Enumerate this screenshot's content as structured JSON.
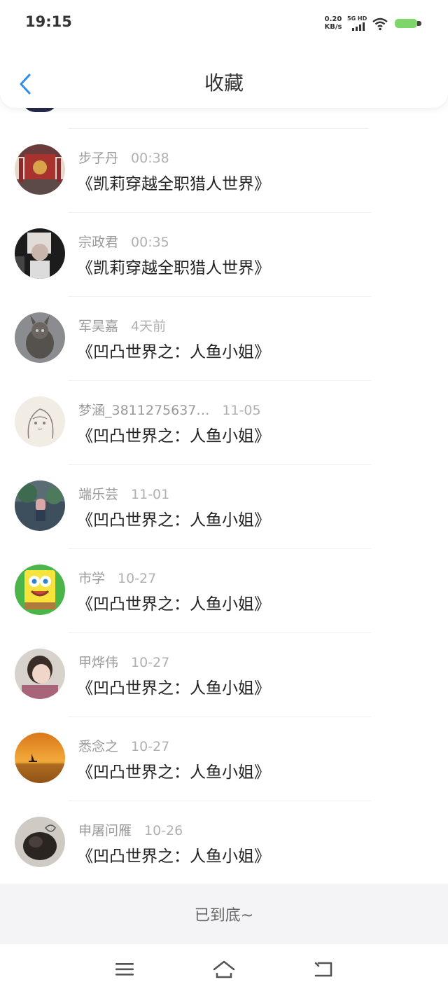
{
  "status_bar": {
    "time": "19:15",
    "net_speed_value": "0.20",
    "net_speed_unit": "KB/s",
    "network_type": "5G HD",
    "battery_color": "#7ed66b"
  },
  "header": {
    "title": "收藏",
    "back_icon": "chevron-left-icon",
    "accent_color": "#2d8cf0"
  },
  "items": [
    {
      "user": "步子丹",
      "time": "00:38",
      "title": "《凯莉穿越全职猎人世界》",
      "avatar": "avatar-temple"
    },
    {
      "user": "宗政君",
      "time": "00:35",
      "title": "《凯莉穿越全职猎人世界》",
      "avatar": "avatar-portrait-bw"
    },
    {
      "user": "军昊嘉",
      "time": "4天前",
      "title": "《凹凸世界之：人鱼小姐》",
      "avatar": "avatar-statue"
    },
    {
      "user": "梦涵_3811275637…",
      "time": "11-05",
      "title": "《凹凸世界之：人鱼小姐》",
      "avatar": "avatar-sketch"
    },
    {
      "user": "端乐芸",
      "time": "11-01",
      "title": "《凹凸世界之：人鱼小姐》",
      "avatar": "avatar-anime-scene"
    },
    {
      "user": "市学",
      "time": "10-27",
      "title": "《凹凸世界之：人鱼小姐》",
      "avatar": "avatar-sponge"
    },
    {
      "user": "甲烨伟",
      "time": "10-27",
      "title": "《凹凸世界之：人鱼小姐》",
      "avatar": "avatar-child"
    },
    {
      "user": "悉念之",
      "time": "10-27",
      "title": "《凹凸世界之：人鱼小姐》",
      "avatar": "avatar-sunset"
    },
    {
      "user": "申屠问雁",
      "time": "10-26",
      "title": "《凹凸世界之：人鱼小姐》",
      "avatar": "avatar-dark-sketch"
    }
  ],
  "footer": {
    "end_text": "已到底~"
  },
  "nav": {
    "menu_icon": "menu-icon",
    "home_icon": "home-icon",
    "back_icon": "back-icon"
  }
}
